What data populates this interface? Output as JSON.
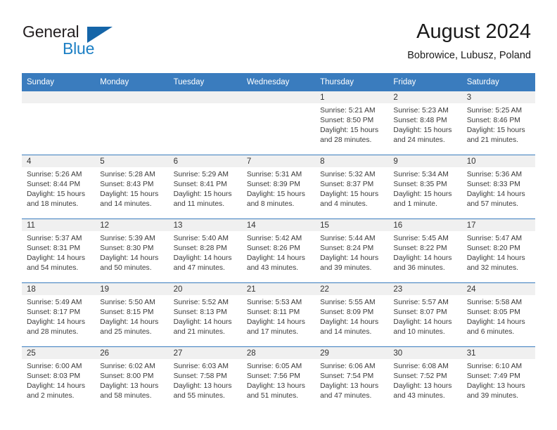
{
  "brand": {
    "name_part1": "General",
    "name_part2": "Blue",
    "logo_icon": "triangle-flag-icon",
    "accent_color": "#1c7fc4"
  },
  "header": {
    "title": "August 2024",
    "location": "Bobrowice, Lubusz, Poland"
  },
  "theme": {
    "header_row_bg": "#3a7cbe",
    "daynum_band_bg": "#f0f0f0",
    "grid_line": "#3a7cbe",
    "text": "#3a3a3a"
  },
  "calendar": {
    "weekday_headers": [
      "Sunday",
      "Monday",
      "Tuesday",
      "Wednesday",
      "Thursday",
      "Friday",
      "Saturday"
    ],
    "weeks": [
      [
        {
          "day": "",
          "lines": []
        },
        {
          "day": "",
          "lines": []
        },
        {
          "day": "",
          "lines": []
        },
        {
          "day": "",
          "lines": []
        },
        {
          "day": "1",
          "lines": [
            "Sunrise: 5:21 AM",
            "Sunset: 8:50 PM",
            "Daylight: 15 hours",
            "and 28 minutes."
          ]
        },
        {
          "day": "2",
          "lines": [
            "Sunrise: 5:23 AM",
            "Sunset: 8:48 PM",
            "Daylight: 15 hours",
            "and 24 minutes."
          ]
        },
        {
          "day": "3",
          "lines": [
            "Sunrise: 5:25 AM",
            "Sunset: 8:46 PM",
            "Daylight: 15 hours",
            "and 21 minutes."
          ]
        }
      ],
      [
        {
          "day": "4",
          "lines": [
            "Sunrise: 5:26 AM",
            "Sunset: 8:44 PM",
            "Daylight: 15 hours",
            "and 18 minutes."
          ]
        },
        {
          "day": "5",
          "lines": [
            "Sunrise: 5:28 AM",
            "Sunset: 8:43 PM",
            "Daylight: 15 hours",
            "and 14 minutes."
          ]
        },
        {
          "day": "6",
          "lines": [
            "Sunrise: 5:29 AM",
            "Sunset: 8:41 PM",
            "Daylight: 15 hours",
            "and 11 minutes."
          ]
        },
        {
          "day": "7",
          "lines": [
            "Sunrise: 5:31 AM",
            "Sunset: 8:39 PM",
            "Daylight: 15 hours",
            "and 8 minutes."
          ]
        },
        {
          "day": "8",
          "lines": [
            "Sunrise: 5:32 AM",
            "Sunset: 8:37 PM",
            "Daylight: 15 hours",
            "and 4 minutes."
          ]
        },
        {
          "day": "9",
          "lines": [
            "Sunrise: 5:34 AM",
            "Sunset: 8:35 PM",
            "Daylight: 15 hours",
            "and 1 minute."
          ]
        },
        {
          "day": "10",
          "lines": [
            "Sunrise: 5:36 AM",
            "Sunset: 8:33 PM",
            "Daylight: 14 hours",
            "and 57 minutes."
          ]
        }
      ],
      [
        {
          "day": "11",
          "lines": [
            "Sunrise: 5:37 AM",
            "Sunset: 8:31 PM",
            "Daylight: 14 hours",
            "and 54 minutes."
          ]
        },
        {
          "day": "12",
          "lines": [
            "Sunrise: 5:39 AM",
            "Sunset: 8:30 PM",
            "Daylight: 14 hours",
            "and 50 minutes."
          ]
        },
        {
          "day": "13",
          "lines": [
            "Sunrise: 5:40 AM",
            "Sunset: 8:28 PM",
            "Daylight: 14 hours",
            "and 47 minutes."
          ]
        },
        {
          "day": "14",
          "lines": [
            "Sunrise: 5:42 AM",
            "Sunset: 8:26 PM",
            "Daylight: 14 hours",
            "and 43 minutes."
          ]
        },
        {
          "day": "15",
          "lines": [
            "Sunrise: 5:44 AM",
            "Sunset: 8:24 PM",
            "Daylight: 14 hours",
            "and 39 minutes."
          ]
        },
        {
          "day": "16",
          "lines": [
            "Sunrise: 5:45 AM",
            "Sunset: 8:22 PM",
            "Daylight: 14 hours",
            "and 36 minutes."
          ]
        },
        {
          "day": "17",
          "lines": [
            "Sunrise: 5:47 AM",
            "Sunset: 8:20 PM",
            "Daylight: 14 hours",
            "and 32 minutes."
          ]
        }
      ],
      [
        {
          "day": "18",
          "lines": [
            "Sunrise: 5:49 AM",
            "Sunset: 8:17 PM",
            "Daylight: 14 hours",
            "and 28 minutes."
          ]
        },
        {
          "day": "19",
          "lines": [
            "Sunrise: 5:50 AM",
            "Sunset: 8:15 PM",
            "Daylight: 14 hours",
            "and 25 minutes."
          ]
        },
        {
          "day": "20",
          "lines": [
            "Sunrise: 5:52 AM",
            "Sunset: 8:13 PM",
            "Daylight: 14 hours",
            "and 21 minutes."
          ]
        },
        {
          "day": "21",
          "lines": [
            "Sunrise: 5:53 AM",
            "Sunset: 8:11 PM",
            "Daylight: 14 hours",
            "and 17 minutes."
          ]
        },
        {
          "day": "22",
          "lines": [
            "Sunrise: 5:55 AM",
            "Sunset: 8:09 PM",
            "Daylight: 14 hours",
            "and 14 minutes."
          ]
        },
        {
          "day": "23",
          "lines": [
            "Sunrise: 5:57 AM",
            "Sunset: 8:07 PM",
            "Daylight: 14 hours",
            "and 10 minutes."
          ]
        },
        {
          "day": "24",
          "lines": [
            "Sunrise: 5:58 AM",
            "Sunset: 8:05 PM",
            "Daylight: 14 hours",
            "and 6 minutes."
          ]
        }
      ],
      [
        {
          "day": "25",
          "lines": [
            "Sunrise: 6:00 AM",
            "Sunset: 8:03 PM",
            "Daylight: 14 hours",
            "and 2 minutes."
          ]
        },
        {
          "day": "26",
          "lines": [
            "Sunrise: 6:02 AM",
            "Sunset: 8:00 PM",
            "Daylight: 13 hours",
            "and 58 minutes."
          ]
        },
        {
          "day": "27",
          "lines": [
            "Sunrise: 6:03 AM",
            "Sunset: 7:58 PM",
            "Daylight: 13 hours",
            "and 55 minutes."
          ]
        },
        {
          "day": "28",
          "lines": [
            "Sunrise: 6:05 AM",
            "Sunset: 7:56 PM",
            "Daylight: 13 hours",
            "and 51 minutes."
          ]
        },
        {
          "day": "29",
          "lines": [
            "Sunrise: 6:06 AM",
            "Sunset: 7:54 PM",
            "Daylight: 13 hours",
            "and 47 minutes."
          ]
        },
        {
          "day": "30",
          "lines": [
            "Sunrise: 6:08 AM",
            "Sunset: 7:52 PM",
            "Daylight: 13 hours",
            "and 43 minutes."
          ]
        },
        {
          "day": "31",
          "lines": [
            "Sunrise: 6:10 AM",
            "Sunset: 7:49 PM",
            "Daylight: 13 hours",
            "and 39 minutes."
          ]
        }
      ]
    ]
  }
}
